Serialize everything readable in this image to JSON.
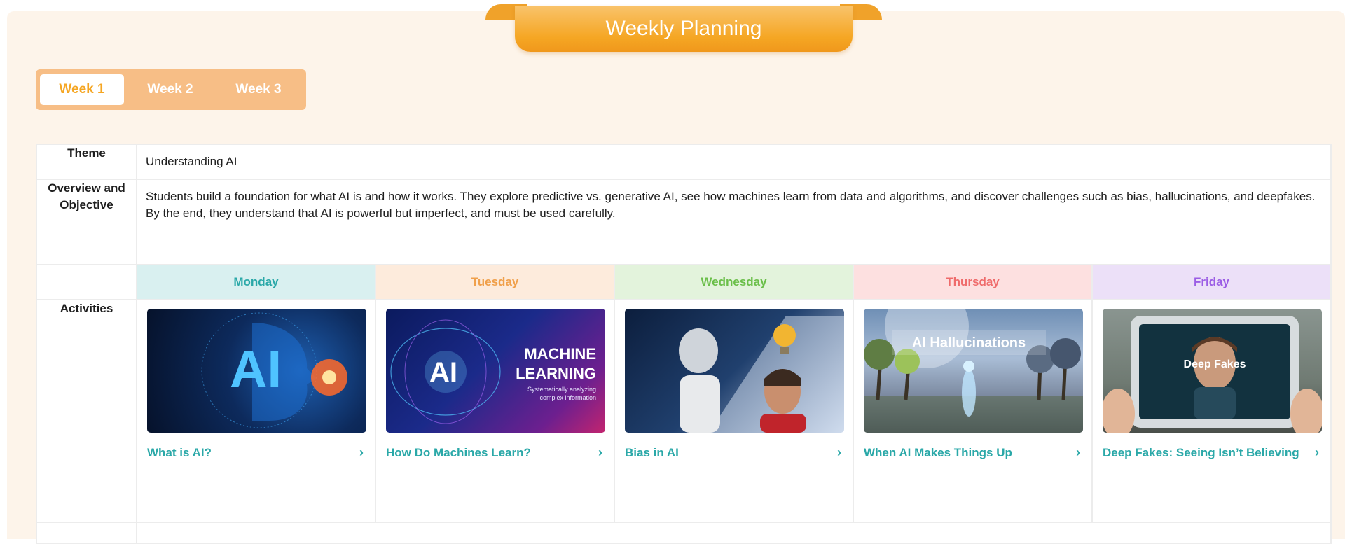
{
  "header": {
    "title": "Weekly Planning"
  },
  "weeks": [
    {
      "label": "Week 1",
      "active": true
    },
    {
      "label": "Week 2",
      "active": false
    },
    {
      "label": "Week 3",
      "active": false
    }
  ],
  "plan": {
    "theme_label": "Theme",
    "theme_value": "Understanding AI",
    "overview_label": "Overview and Objective",
    "overview_value": "Students build a foundation for what AI is and how it works. They explore predictive vs. generative AI, see how machines learn from data and algorithms, and discover challenges such as bias, hallucinations, and deepfakes. By the end, they understand that AI is powerful but imperfect, and must be used carefully.",
    "activities_label": "Activities"
  },
  "days": [
    {
      "name": "Monday",
      "color": "#2aa8a8",
      "bg": "#d9f0f0"
    },
    {
      "name": "Tuesday",
      "color": "#f0a04b",
      "bg": "#fdebdc"
    },
    {
      "name": "Wednesday",
      "color": "#6bbf4a",
      "bg": "#e3f3dc"
    },
    {
      "name": "Thursday",
      "color": "#ef6b6b",
      "bg": "#fde0e0"
    },
    {
      "name": "Friday",
      "color": "#9b5de5",
      "bg": "#ece0f8"
    }
  ],
  "activities": [
    {
      "title": "What is AI?",
      "thumb_text": "AI",
      "thumb_sub": ""
    },
    {
      "title": "How Do Machines Learn?",
      "thumb_text": "AI",
      "thumb_sub": "MACHINE LEARNING",
      "thumb_caption": "Systematically analyzing complex information"
    },
    {
      "title": "Bias in AI",
      "thumb_text": "",
      "thumb_sub": ""
    },
    {
      "title": "When AI Makes Things Up",
      "thumb_text": "AI Hallucinations",
      "thumb_sub": ""
    },
    {
      "title": "Deep Fakes: Seeing Isn’t Believing",
      "thumb_text": "Deep Fakes",
      "thumb_sub": ""
    }
  ],
  "icons": {
    "chevron": "chevron-right-icon"
  }
}
